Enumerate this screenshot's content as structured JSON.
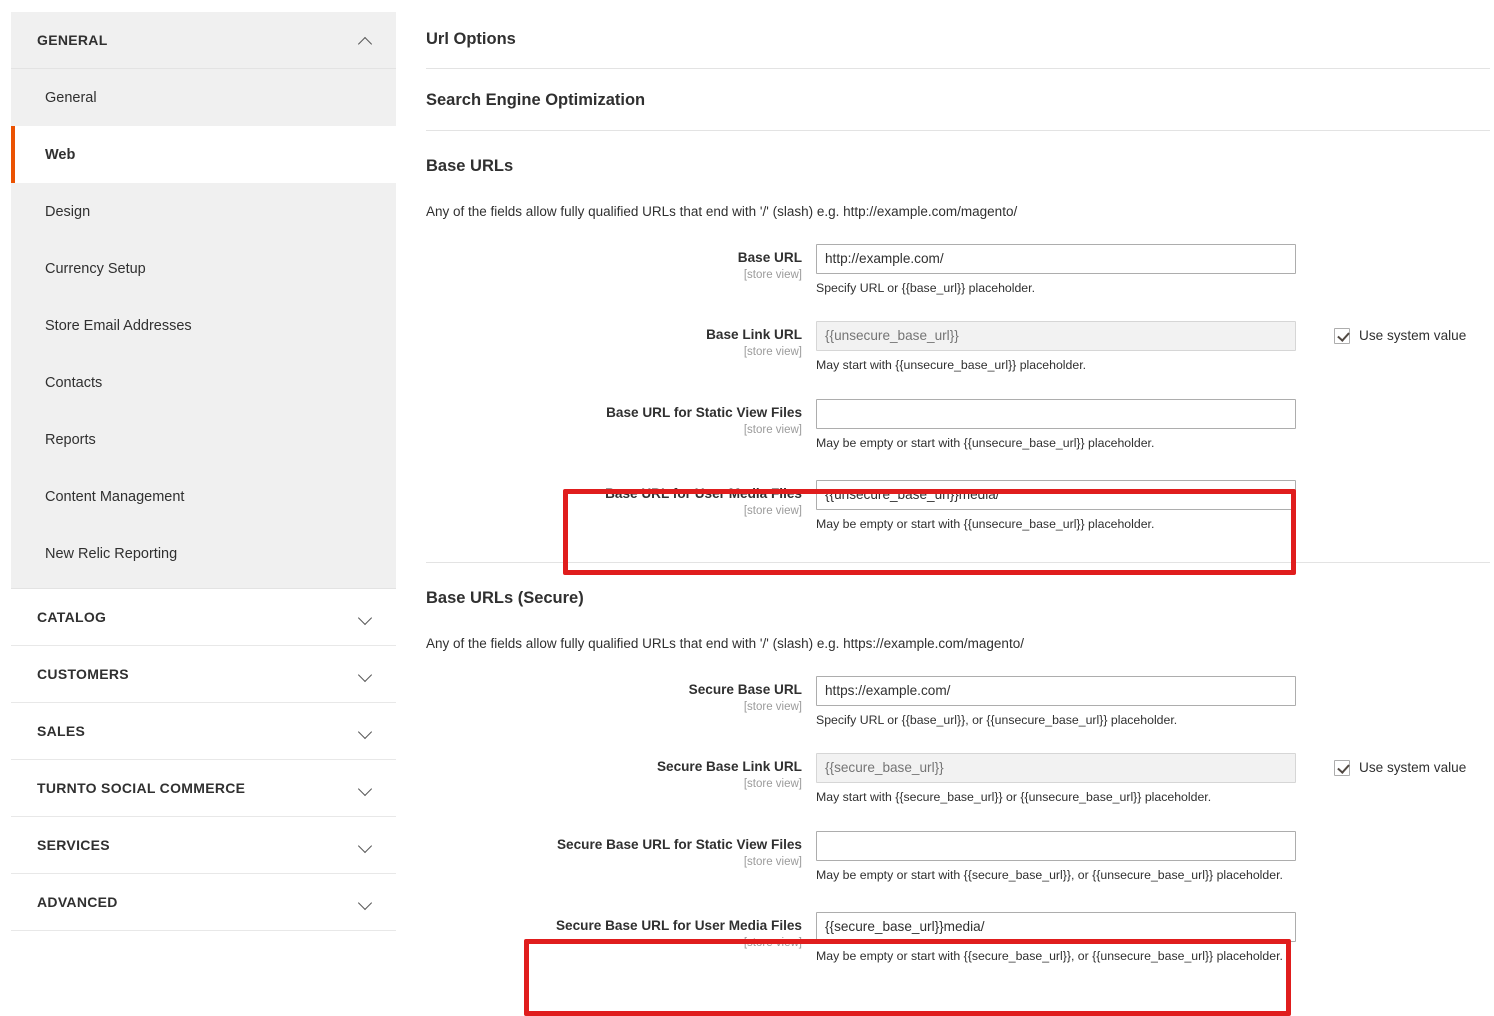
{
  "sidebar": {
    "expanded_group": {
      "label": "GENERAL",
      "chevron": "chevron-up-icon",
      "items": [
        {
          "label": "General",
          "active": false
        },
        {
          "label": "Web",
          "active": true
        },
        {
          "label": "Design",
          "active": false
        },
        {
          "label": "Currency Setup",
          "active": false
        },
        {
          "label": "Store Email Addresses",
          "active": false
        },
        {
          "label": "Contacts",
          "active": false
        },
        {
          "label": "Reports",
          "active": false
        },
        {
          "label": "Content Management",
          "active": false
        },
        {
          "label": "New Relic Reporting",
          "active": false
        }
      ]
    },
    "collapsed_groups": [
      {
        "label": "CATALOG",
        "chevron": "chevron-down-icon"
      },
      {
        "label": "CUSTOMERS",
        "chevron": "chevron-down-icon"
      },
      {
        "label": "SALES",
        "chevron": "chevron-down-icon"
      },
      {
        "label": "TURNTO SOCIAL COMMERCE",
        "chevron": "chevron-down-icon"
      },
      {
        "label": "SERVICES",
        "chevron": "chevron-down-icon"
      },
      {
        "label": "ADVANCED",
        "chevron": "chevron-down-icon"
      }
    ],
    "accent_color": "#eb5202"
  },
  "main": {
    "url_options_title": "Url Options",
    "seo_title": "Search Engine Optimization",
    "base_urls": {
      "title": "Base URLs",
      "note": "Any of the fields allow fully qualified URLs that end with '/' (slash) e.g. http://example.com/magento/",
      "fields": [
        {
          "label": "Base URL",
          "scope": "[store view]",
          "value": "http://example.com/",
          "placeholder": "",
          "disabled": false,
          "hint": "Specify URL or {{base_url}} placeholder.",
          "use_system_value": null,
          "highlighted": false
        },
        {
          "label": "Base Link URL",
          "scope": "[store view]",
          "value": "",
          "placeholder": "{{unsecure_base_url}}",
          "disabled": true,
          "hint": "May start with {{unsecure_base_url}} placeholder.",
          "use_system_value": {
            "label": "Use system value",
            "checked": true
          },
          "highlighted": false
        },
        {
          "label": "Base URL for Static View Files",
          "scope": "[store view]",
          "value": "",
          "placeholder": "",
          "disabled": false,
          "hint": "May be empty or start with {{unsecure_base_url}} placeholder.",
          "use_system_value": null,
          "highlighted": false
        },
        {
          "label": "Base URL for User Media Files",
          "scope": "[store view]",
          "value": "{{unsecure_base_url}}media/",
          "placeholder": "",
          "disabled": false,
          "hint": "May be empty or start with {{unsecure_base_url}} placeholder.",
          "use_system_value": null,
          "highlighted": true
        }
      ]
    },
    "base_urls_secure": {
      "title": "Base URLs (Secure)",
      "note": "Any of the fields allow fully qualified URLs that end with '/' (slash) e.g. https://example.com/magento/",
      "fields": [
        {
          "label": "Secure Base URL",
          "scope": "[store view]",
          "value": "https://example.com/",
          "placeholder": "",
          "disabled": false,
          "hint": "Specify URL or {{base_url}}, or {{unsecure_base_url}} placeholder.",
          "use_system_value": null,
          "highlighted": false
        },
        {
          "label": "Secure Base Link URL",
          "scope": "[store view]",
          "value": "",
          "placeholder": "{{secure_base_url}}",
          "disabled": true,
          "hint": "May start with {{secure_base_url}} or {{unsecure_base_url}} placeholder.",
          "use_system_value": {
            "label": "Use system value",
            "checked": true
          },
          "highlighted": false
        },
        {
          "label": "Secure Base URL for Static View Files",
          "scope": "[store view]",
          "value": "",
          "placeholder": "",
          "disabled": false,
          "hint": "May be empty or start with {{secure_base_url}}, or {{unsecure_base_url}} placeholder.",
          "use_system_value": null,
          "highlighted": false
        },
        {
          "label": "Secure Base URL for User Media Files",
          "scope": "[store view]",
          "value": "{{secure_base_url}}media/",
          "placeholder": "",
          "disabled": false,
          "hint": "May be empty or start with {{secure_base_url}}, or {{unsecure_base_url}} placeholder.",
          "use_system_value": null,
          "highlighted": true
        }
      ]
    },
    "highlight_color": "#e01d1d"
  }
}
